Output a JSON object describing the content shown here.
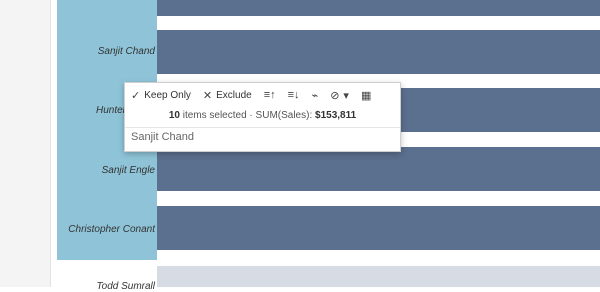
{
  "rows": [
    {
      "name": "Sanjit Chand"
    },
    {
      "name": "Hunter"
    },
    {
      "name": "Sanjit Engle"
    },
    {
      "name": "Christopher Conant"
    },
    {
      "name": "Todd Sumrall"
    }
  ],
  "tooltip": {
    "keep_only": "Keep Only",
    "exclude": "Exclude",
    "selected_count": "10",
    "selected_text": "items selected",
    "separator": "·",
    "measure_label": "SUM(Sales):",
    "measure_value": "$153,811",
    "field_value": "Sanjit Chand"
  },
  "icons": {
    "keep_only": "check-icon",
    "exclude": "x-icon",
    "sort_asc": "sort-ascending-icon",
    "sort_desc": "sort-descending-icon",
    "link": "paperclip-icon",
    "group": "group-icon",
    "view_data": "view-data-icon"
  },
  "colors": {
    "selected_bar": "#5b6f8e",
    "unselected_bar": "#d7dbe3",
    "label_band": "#8fc4d8"
  }
}
